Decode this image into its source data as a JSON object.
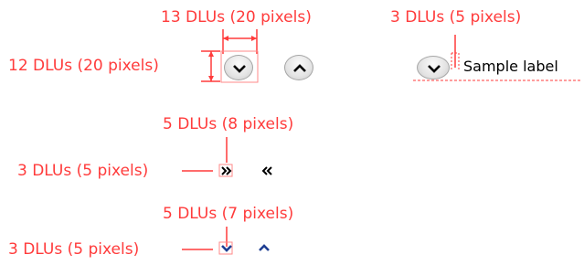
{
  "annotations": {
    "width_large": "13 DLUs (20 pixels)",
    "spacing_label": "3 DLUs (5 pixels)",
    "height_large": "12 DLUs (20 pixels)",
    "width_chevron_small": "5 DLUs (8 pixels)",
    "spacing_chevron_small": "3 DLUs (5 pixels)",
    "width_arrow_small": "5 DLUs (7 pixels)",
    "spacing_arrow_small": "3 DLUs (5 pixels)"
  },
  "sample_label": "Sample label",
  "icons": [
    "chevron-down-button",
    "chevron-up-button",
    "double-chevron-right",
    "double-chevron-left",
    "arrow-down",
    "arrow-up"
  ],
  "colors": {
    "annotation": "#ff3b3b",
    "button_border": "#a6a6a6",
    "small_arrow": "#1f3f93",
    "chevron_glyph": "#000000"
  }
}
